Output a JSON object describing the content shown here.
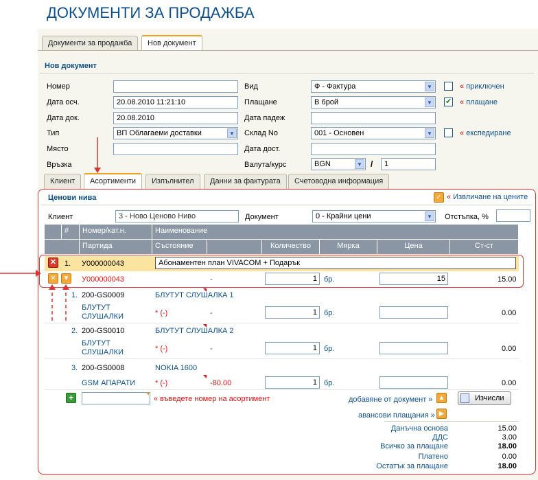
{
  "page": {
    "title": "ДОКУМЕНТИ ЗА ПРОДАЖБА"
  },
  "tabs": [
    {
      "label": "Документи за продажба"
    },
    {
      "label": "Нов документ"
    }
  ],
  "section": {
    "title": "Нов документ"
  },
  "form": {
    "nomer": {
      "label": "Номер",
      "value": ""
    },
    "data_osch": {
      "label": "Дата осч.",
      "value": "20.08.2010 11:21:10"
    },
    "data_dok": {
      "label": "Дата док.",
      "value": "20.08.2010"
    },
    "tip": {
      "label": "Тип",
      "value": "ВП Облагаеми доставки"
    },
    "masto": {
      "label": "Място",
      "value": ""
    },
    "vrazka": {
      "label": "Връзка"
    },
    "vid": {
      "label": "Вид",
      "value": "Ф - Фактура"
    },
    "plashtane": {
      "label": "Плащане",
      "value": "В брой"
    },
    "data_padezh": {
      "label": "Дата падеж",
      "value": ""
    },
    "sklad": {
      "label": "Склад No",
      "value": "001 - Основен"
    },
    "data_dost": {
      "label": "Дата дост.",
      "value": ""
    },
    "valuta": {
      "label": "Валута/курс",
      "value": "BGN",
      "sep": "/",
      "rate": "1"
    },
    "chk_priklyuchen": {
      "label": "приключен",
      "checked": false
    },
    "chk_plashtane": {
      "label": "плащане",
      "checked": true
    },
    "chk_ekspedirane": {
      "label": "експедиране",
      "checked": false
    },
    "quote_mark": "«"
  },
  "subtabs": [
    {
      "label": "Клиент"
    },
    {
      "label": "Асортименти"
    },
    {
      "label": "Изпълнител"
    },
    {
      "label": "Данни за фактурата"
    },
    {
      "label": "Счетоводна информация"
    }
  ],
  "prices": {
    "title": "Ценови нива",
    "extract_label": "Извличане на цените",
    "client_label": "Клиент",
    "client_value": "3 - Ново Ценово Ниво",
    "document_label": "Документ",
    "document_value": "0 - Крайни цени",
    "discount_label": "Отстъпка, %",
    "discount_value": ""
  },
  "table": {
    "headers_row1": {
      "num": "#",
      "code": "Номер/кат.н.",
      "name": "Наименование"
    },
    "headers_row2": {
      "batch": "Партида",
      "state": "Състояние",
      "qty": "Количество",
      "unit": "Мярка",
      "price": "Цена",
      "value": "Ст-ст"
    },
    "main_item": {
      "num": "1.",
      "code": "У000000043",
      "name": "Абонаментен план VIVACOM + Подарък",
      "batch": "У000000043",
      "state": "-",
      "qty": "1",
      "unit": "бр.",
      "price": "15",
      "value": "15.00"
    },
    "sub_items": [
      {
        "num": "1.",
        "code": "200-GS0009",
        "name": "БЛУТУТ СЛУШАЛКА 1",
        "group": "БЛУТУТ СЛУШАЛКИ",
        "state": "* (-)",
        "state2": "-",
        "qty": "1",
        "unit": "бр.",
        "price": "",
        "value": "0.00"
      },
      {
        "num": "2.",
        "code": "200-GS0010",
        "name": "БЛУТУТ СЛУШАЛКА 2",
        "group": "БЛУТУТ СЛУШАЛКИ",
        "state": "* (-)",
        "state2": "-",
        "qty": "1",
        "unit": "бр.",
        "price": "",
        "value": "0.00"
      },
      {
        "num": "3.",
        "code": "200-GS0008",
        "name": "NOKIA 1600",
        "group": "GSM АПАРАТИ",
        "state": "* (-)",
        "state2": "-80.00",
        "qty": "1",
        "unit": "бр.",
        "price": "",
        "value": "0.00"
      }
    ],
    "add_hint": "« въведете номер на асортимент",
    "add_from_doc": "добавяне от документ »",
    "calc_button": "Изчисли",
    "advance": "авансови плащания »"
  },
  "summary": [
    {
      "label": "Данъчна основа",
      "value": "15.00",
      "bold": false
    },
    {
      "label": "ДДС",
      "value": "3.00",
      "bold": false
    },
    {
      "label": "Всичко за плащане",
      "value": "18.00",
      "bold": true
    },
    {
      "label": "Платено",
      "value": "0.00",
      "bold": false
    },
    {
      "label": "Остатък за плащане",
      "value": "18.00",
      "bold": true
    }
  ],
  "colors": {
    "title": "#0e4f8b",
    "accent": "#f3a83a",
    "annotation": "#d33"
  },
  "icons": [
    "delete-icon",
    "remove-icon",
    "expand-icon",
    "add-icon",
    "calculator-icon",
    "checkmark-icon"
  ]
}
